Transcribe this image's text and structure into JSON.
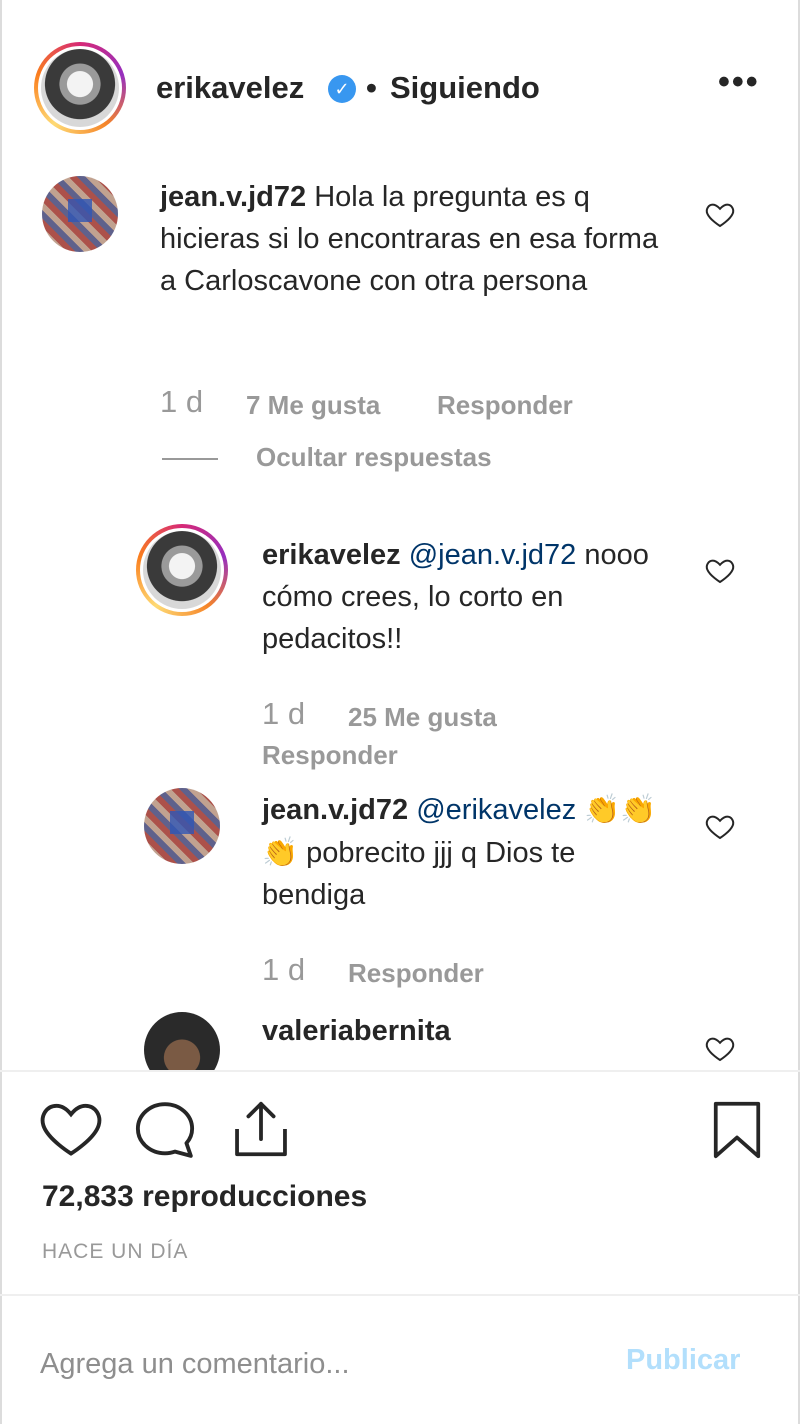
{
  "header": {
    "username": "erikavelez",
    "verified_icon": "verified-badge-icon",
    "separator": "•",
    "follow_status": "Siguiendo",
    "more_icon": "more-options-icon"
  },
  "comments": [
    {
      "username": "jean.v.jd72",
      "text": "Hola la pregunta es q hicieras si lo encontraras en esa forma a Carloscavone con otra persona",
      "time": "1 d",
      "likes": "7 Me gusta",
      "reply": "Responder",
      "hide_replies": "Ocultar respuestas"
    },
    {
      "username": "erikavelez",
      "mention": "@jean.v.jd72",
      "text": "nooo cómo crees, lo corto en pedacitos!!",
      "time": "1 d",
      "likes": "25 Me gusta",
      "reply": "Responder"
    },
    {
      "username": "jean.v.jd72",
      "mention": "@erikavelez",
      "emoji": "👏👏👏",
      "text": "pobrecito jjj q Dios te bendiga",
      "time": "1 d",
      "reply": "Responder"
    },
    {
      "username": "valeriabernita"
    }
  ],
  "actions": {
    "like_icon": "heart-icon",
    "comment_icon": "comment-icon",
    "share_icon": "share-icon",
    "save_icon": "bookmark-icon"
  },
  "stats": {
    "views": "72,833 reproducciones",
    "posted": "HACE UN DÍA"
  },
  "add_comment": {
    "placeholder": "Agrega un comentario...",
    "publish": "Publicar"
  },
  "colors": {
    "text": "#262626",
    "muted": "#999999",
    "link": "#003569",
    "verified": "#3897f0",
    "publish_disabled": "#b2dffc"
  }
}
